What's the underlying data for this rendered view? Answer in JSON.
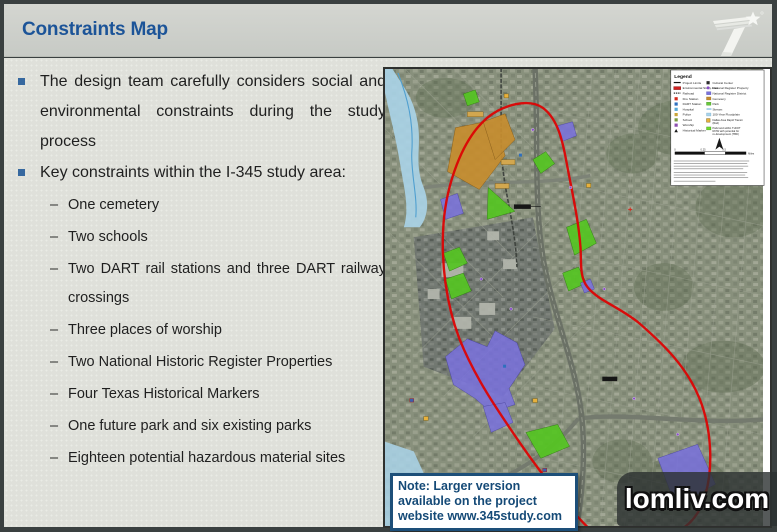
{
  "slide": {
    "title": "Constraints Map",
    "watermark": "lomliv.com"
  },
  "bullets": {
    "dash": "–",
    "items": [
      {
        "text": "The design team carefully considers social and environmental constraints during the study process"
      },
      {
        "text": "Key constraints within the I-345 study area:"
      }
    ],
    "sub_items": [
      "One cemetery",
      "Two schools",
      "Two DART rail stations and three DART railway crossings",
      "Three places of worship",
      "Two National Historic Register Properties",
      "Four Texas Historical Markers",
      "One future park and six existing parks",
      "Eighteen potential hazardous material sites"
    ]
  },
  "map": {
    "note_lines": [
      "Note: Larger version",
      "available on the project",
      "website www.345study.com"
    ],
    "legend": {
      "title": "Legend",
      "left": [
        {
          "label": "Project Limits"
        },
        {
          "label": "Environmental Study Area"
        },
        {
          "label": "Railroad"
        },
        {
          "label": "Fire Station"
        },
        {
          "label": "DART Station"
        },
        {
          "label": "Hospital"
        },
        {
          "label": "Police"
        },
        {
          "label": "School"
        },
        {
          "label": "Worship"
        },
        {
          "label": "Historical Marker"
        }
      ],
      "right": [
        {
          "label": "Cultural Center"
        },
        {
          "label": "National Register Property"
        },
        {
          "label": "National Register District"
        },
        {
          "label": "Cemetery"
        },
        {
          "label": "Park"
        },
        {
          "label": "Stream"
        },
        {
          "label": "100-Year Floodplain"
        },
        {
          "label": "Dallas Area Rapid Transit (Rail)",
          "lines": [
            "Dallas Area Rapid Transit",
            "(Rail)"
          ]
        },
        {
          "label": "Park land within TxDOT ROW with potential for re-development (TBD)",
          "lines": [
            "Park land within TxDOT",
            "ROW with potential for",
            "re-development (TBD)"
          ]
        }
      ],
      "scale_labels": [
        "0",
        "0.25",
        "0.5"
      ],
      "scale_unit": "Miles"
    }
  },
  "colors": {
    "title_blue": "#1c5498",
    "bullet_blue": "#36689f",
    "boundary_red": "#dc0404",
    "park_green": "#55c522",
    "district_purple": "#7a72db",
    "cemetery_tan": "#c68d2f",
    "floodplain_blue": "#aad3ea",
    "note_blue": "#1d4f79"
  }
}
